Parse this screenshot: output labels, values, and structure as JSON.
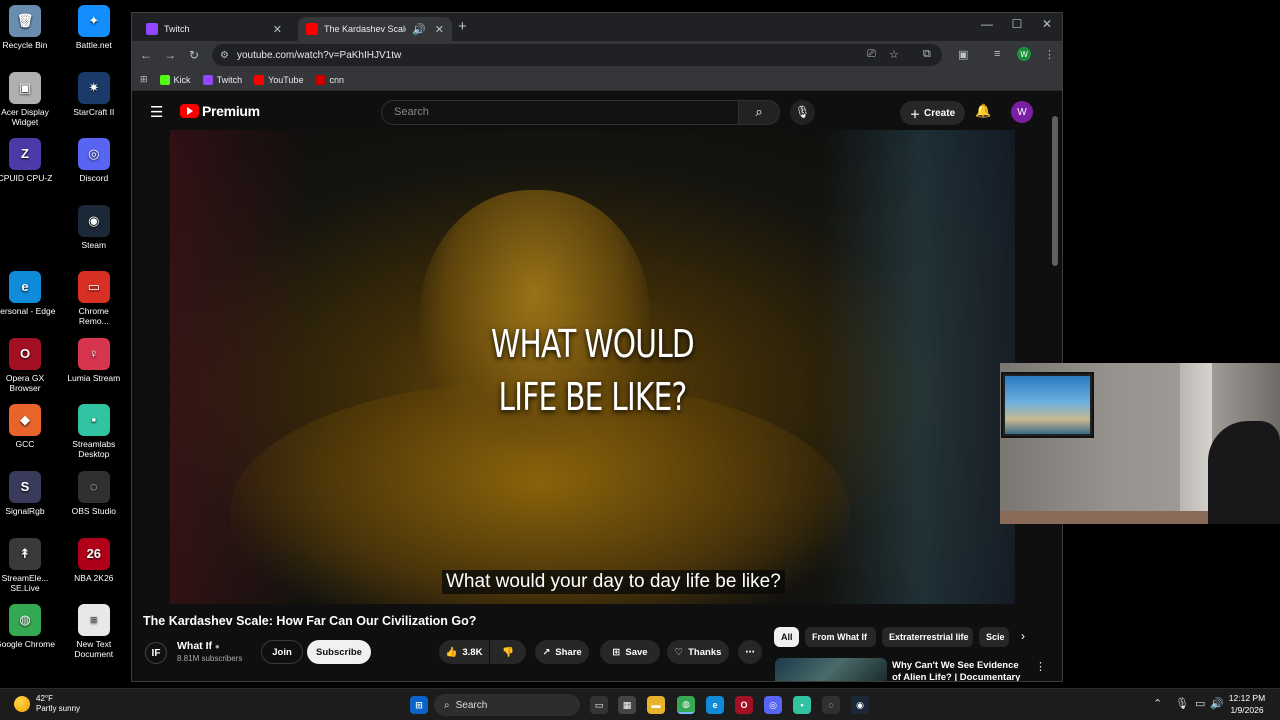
{
  "desktop": {
    "icons": [
      {
        "label": "Recycle Bin",
        "glyph": "🗑",
        "color": "#6a8caf"
      },
      {
        "label": "Battle.net",
        "glyph": "✦",
        "color": "#148eff"
      },
      {
        "label": "Acer Display Widget",
        "glyph": "▣",
        "color": "#b0b0b0"
      },
      {
        "label": "StarCraft II",
        "glyph": "✷",
        "color": "#1a3a6a"
      },
      {
        "label": "CPUID CPU-Z",
        "glyph": "Z",
        "color": "#4b3aa8"
      },
      {
        "label": "Discord",
        "glyph": "◎",
        "color": "#5865f2"
      },
      {
        "label": "Steam",
        "glyph": "◉",
        "color": "#1b2838"
      },
      {
        "label": "Personal - Edge",
        "glyph": "e",
        "color": "#0f8bd9"
      },
      {
        "label": "Chrome Remo...",
        "glyph": "▭",
        "color": "#d93025"
      },
      {
        "label": "Opera GX Browser",
        "glyph": "O",
        "color": "#a31024"
      },
      {
        "label": "Lumia Stream",
        "glyph": "♀",
        "color": "#d6354e"
      },
      {
        "label": "GCC",
        "glyph": "◆",
        "color": "#e8642a"
      },
      {
        "label": "Streamlabs Desktop",
        "glyph": "▪",
        "color": "#31c3a2"
      },
      {
        "label": "SignalRgb",
        "glyph": "S",
        "color": "#3a3a5a"
      },
      {
        "label": "OBS Studio",
        "glyph": "◌",
        "color": "#303030"
      },
      {
        "label": "StreamEle... SE.Live",
        "glyph": "↟",
        "color": "#3a3a3a"
      },
      {
        "label": "NBA 2K26",
        "glyph": "26",
        "color": "#b00018"
      },
      {
        "label": "Google Chrome",
        "glyph": "◍",
        "color": "#34a853"
      },
      {
        "label": "New Text Document",
        "glyph": "≡",
        "color": "#e8e8e8"
      }
    ]
  },
  "browser": {
    "tabs": [
      {
        "title": "Twitch",
        "color": "#9146ff"
      },
      {
        "title": "The Kardashev Scale: How F",
        "color": "#ff0000"
      }
    ],
    "url": "youtube.com/watch?v=PaKhIHJV1tw",
    "bookmarks": [
      {
        "label": "Kick",
        "color": "#53fc18"
      },
      {
        "label": "Twitch",
        "color": "#9146ff"
      },
      {
        "label": "YouTube",
        "color": "#ff0000"
      },
      {
        "label": "cnn",
        "color": "#cc0000"
      }
    ],
    "profile_initial": "W"
  },
  "youtube": {
    "logo_text": "Premium",
    "search_placeholder": "Search",
    "create_label": "Create",
    "avatar_initial": "W",
    "video_overlay_line1": "WHAT WOULD",
    "video_overlay_line2": "LIFE BE LIKE?",
    "caption": "What would your day to day life be like?",
    "video_title": "The Kardashev Scale: How Far Can Our Civilization Go?",
    "channel": {
      "name": "What If",
      "initials": "IF",
      "subscribers": "8.81M subscribers"
    },
    "actions": {
      "join": "Join",
      "subscribe": "Subscribe",
      "likes": "3.8K",
      "share": "Share",
      "save": "Save",
      "thanks": "Thanks"
    },
    "chips": [
      "All",
      "From What If",
      "Extraterrestrial life",
      "Scie"
    ],
    "recommended": [
      {
        "title": "Why Can't We See Evidence of Alien Life? | Documentary"
      }
    ]
  },
  "taskbar": {
    "weather_temp": "42°F",
    "weather_desc": "Partly sunny",
    "search_label": "Search",
    "time": "12:12 PM",
    "date": "1/9/2026"
  }
}
